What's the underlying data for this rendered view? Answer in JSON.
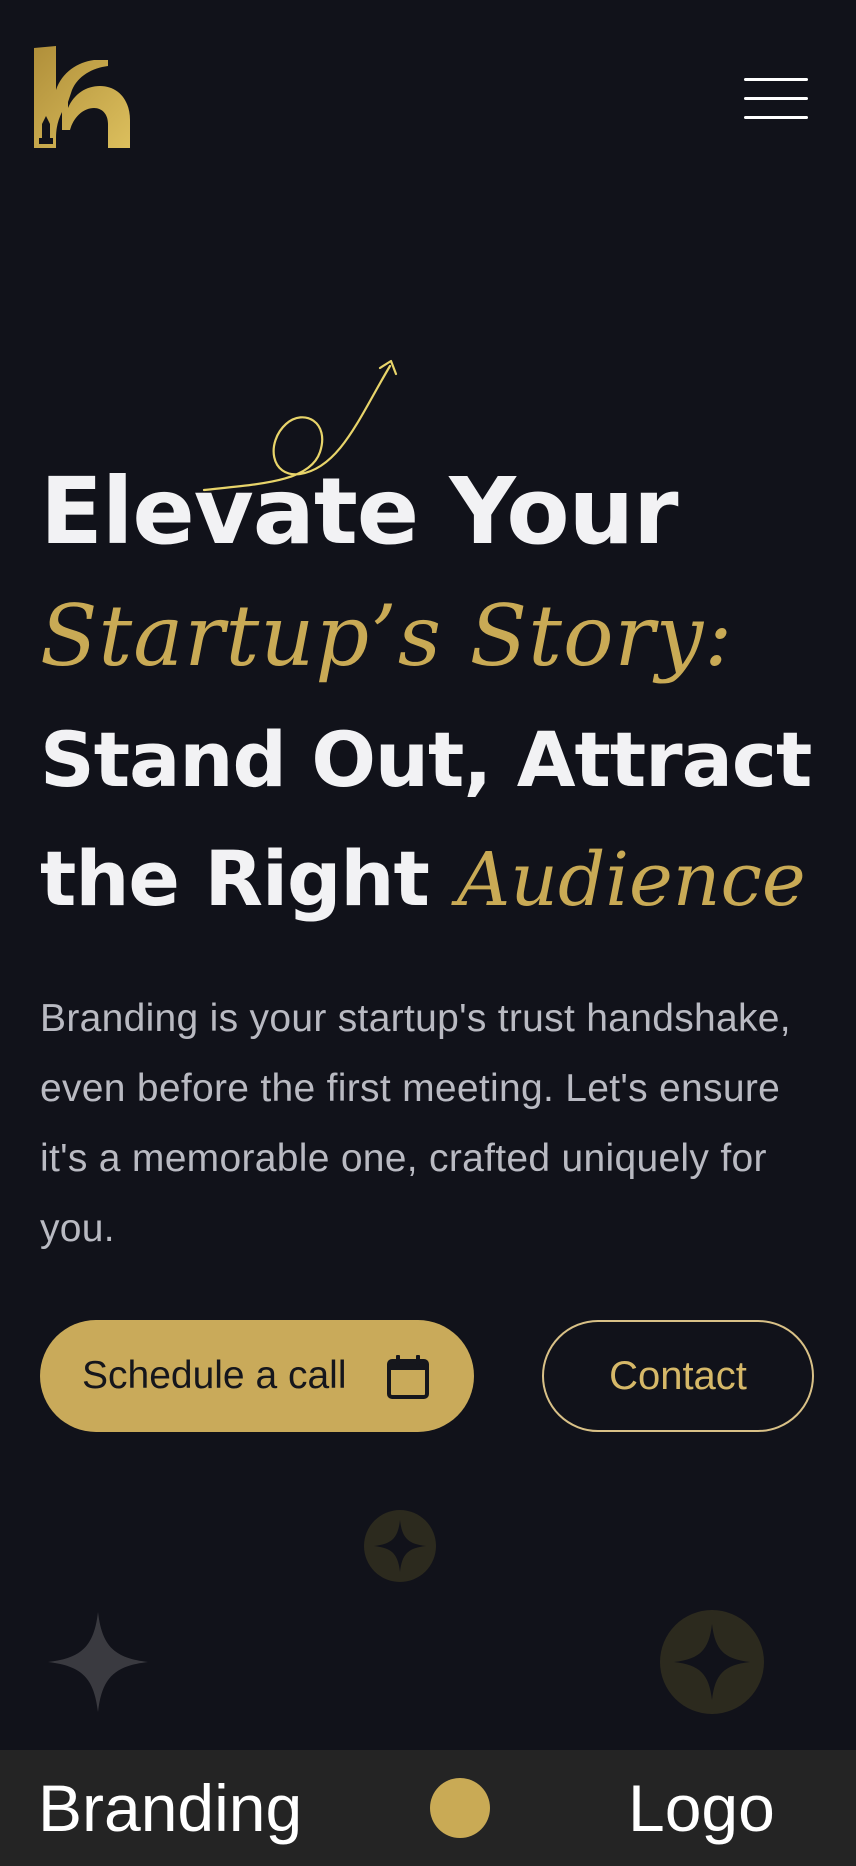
{
  "colors": {
    "background": "#11121a",
    "accent_gold": "#c9aa55",
    "text_light": "#f2f2f4",
    "text_muted": "#b9bac2",
    "ticker_background": "#242424"
  },
  "header": {
    "logo_icon": "k-pen-logo-icon",
    "menu_icon": "hamburger-menu-icon"
  },
  "hero": {
    "line1": "Elevate Your",
    "line2": "Startup’s Story:",
    "line3": "Stand Out, Attract",
    "line4_plain": "the Right",
    "line4_script": "Audience",
    "description": "Branding is your startup's trust handshake, even before the first meeting. Let's ensure it's a memorable one, crafted uniquely for you.",
    "decor_icon": "curly-arrow-icon"
  },
  "actions": {
    "schedule_label": "Schedule a call",
    "schedule_icon": "calendar-icon",
    "contact_label": "Contact"
  },
  "decorations": {
    "icons": [
      "sparkle-circle-icon",
      "sparkle-star-icon",
      "sparkle-circle-icon"
    ]
  },
  "ticker": {
    "items": [
      "Branding",
      "Logo"
    ]
  }
}
